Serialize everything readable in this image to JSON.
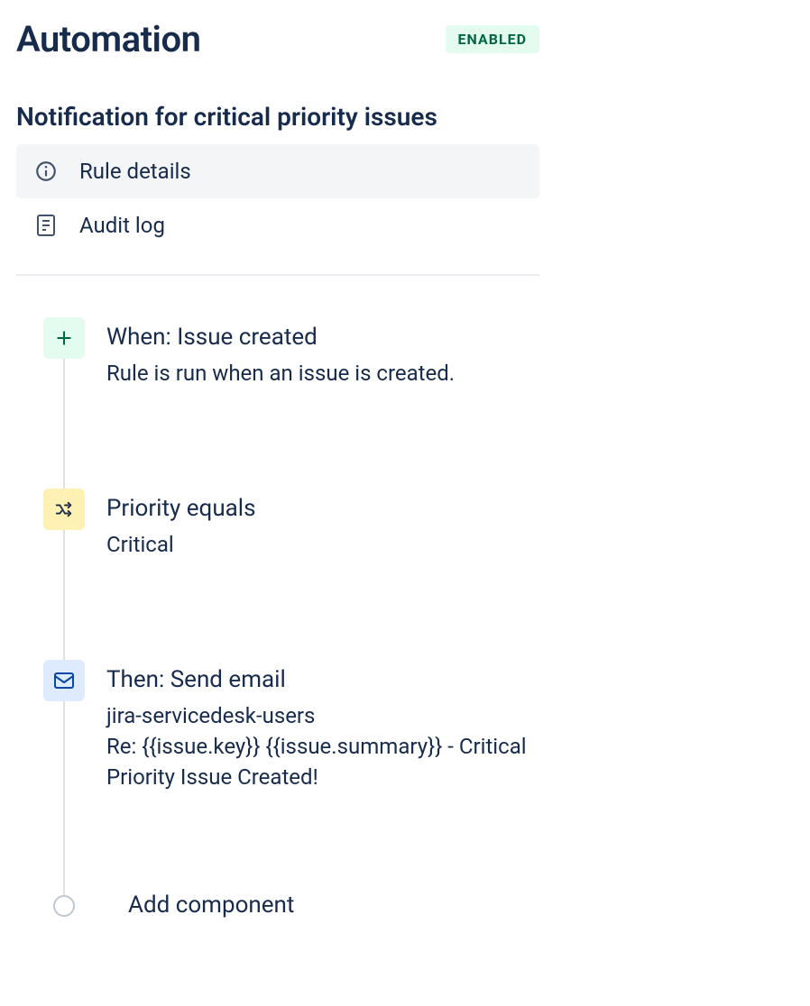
{
  "header": {
    "title": "Automation",
    "status": "ENABLED"
  },
  "rule": {
    "name": "Notification for critical priority issues"
  },
  "panel": {
    "rule_details": "Rule details",
    "audit_log": "Audit log"
  },
  "flow": {
    "trigger": {
      "title": "When: Issue created",
      "desc": "Rule is run when an issue is created."
    },
    "condition": {
      "title": "Priority equals",
      "desc": "Critical"
    },
    "action": {
      "title": "Then: Send email",
      "desc": "jira-servicedesk-users\nRe: {{issue.key}} {{issue.summary}} - Critical Priority Issue Created!"
    },
    "add_component": "Add component"
  }
}
